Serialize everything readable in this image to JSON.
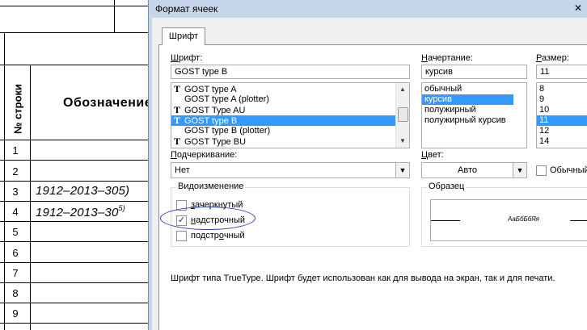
{
  "sheet": {
    "header_col1": "№ строки",
    "header_col2": "Обозначение",
    "rows": [
      {
        "num": "1",
        "text": "",
        "sup": ""
      },
      {
        "num": "2",
        "text": "",
        "sup": ""
      },
      {
        "num": "3",
        "text": "1912–2013–305)",
        "sup": ""
      },
      {
        "num": "4",
        "text": "1912–2013–30",
        "sup": "5)"
      },
      {
        "num": "5",
        "text": "",
        "sup": ""
      },
      {
        "num": "6",
        "text": "",
        "sup": ""
      },
      {
        "num": "7",
        "text": "",
        "sup": ""
      },
      {
        "num": "8",
        "text": "",
        "sup": ""
      },
      {
        "num": "9",
        "text": "",
        "sup": ""
      }
    ]
  },
  "dialog": {
    "title": "Формат ячеек",
    "close_glyph": "✕",
    "tab": "Шрифт",
    "font": {
      "label": "Шрифт:",
      "value": "GOST type B",
      "items": [
        {
          "label": "GOST type A",
          "truetype": true,
          "selected": false
        },
        {
          "label": "GOST type A (plotter)",
          "truetype": false,
          "selected": false
        },
        {
          "label": "GOST Type AU",
          "truetype": true,
          "selected": false
        },
        {
          "label": "GOST type B",
          "truetype": true,
          "selected": true
        },
        {
          "label": "GOST type B (plotter)",
          "truetype": false,
          "selected": false
        },
        {
          "label": "GOST Type BU",
          "truetype": true,
          "selected": false
        }
      ],
      "tt_glyph": "T"
    },
    "style": {
      "label": "Начертание:",
      "value": "курсив",
      "items": [
        {
          "label": "обычный",
          "selected": false
        },
        {
          "label": "курсив",
          "selected": true
        },
        {
          "label": "полужирный",
          "selected": false
        },
        {
          "label": "полужирный курсив",
          "selected": false
        }
      ]
    },
    "size": {
      "label": "Размер:",
      "value": "11",
      "items": [
        {
          "label": "8",
          "selected": false
        },
        {
          "label": "9",
          "selected": false
        },
        {
          "label": "10",
          "selected": false
        },
        {
          "label": "11",
          "selected": true
        },
        {
          "label": "12",
          "selected": false
        },
        {
          "label": "14",
          "selected": false
        }
      ]
    },
    "underline": {
      "label": "Подчеркивание:",
      "value": "Нет"
    },
    "color": {
      "label": "Цвет:",
      "value": "Авто",
      "normal_label": "Обычный"
    },
    "effects": {
      "title": "Видоизменение",
      "strikethrough": {
        "label": "зачеркнутый",
        "checked": false
      },
      "superscript": {
        "label": "надстрочный",
        "checked": true
      },
      "subscript": {
        "label": "подстрочный",
        "checked": false
      }
    },
    "preview": {
      "title": "Образец",
      "text": "АаБбБбЯя"
    },
    "description": "Шрифт типа TrueType. Шрифт будет использован как для вывода на экран, так и для печати.",
    "check_glyph": "✓",
    "arrow_up": "▲",
    "arrow_down": "▼",
    "combo_arrow": "▼",
    "colors": {
      "selection": "#3399ff",
      "annotation": "#2f3fb0"
    }
  }
}
